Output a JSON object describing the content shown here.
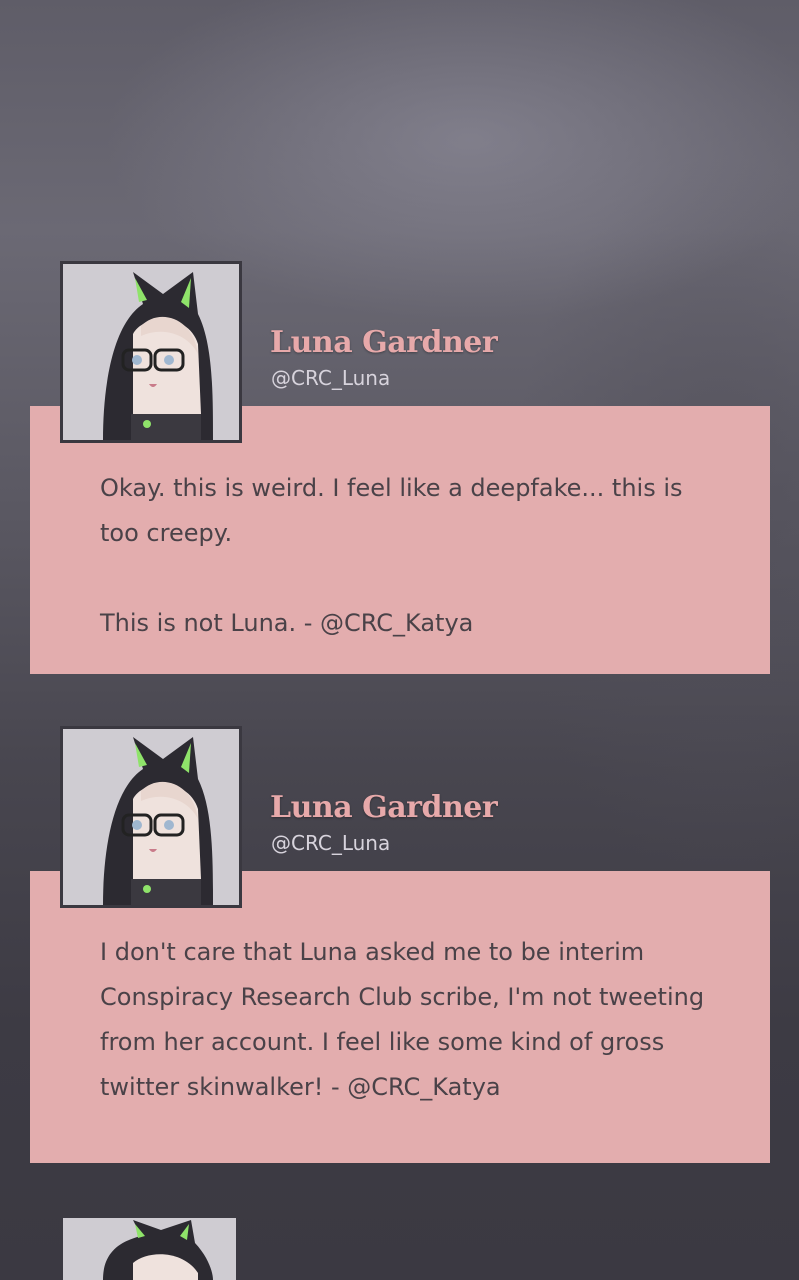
{
  "posts": [
    {
      "author_name": "Luna Gardner",
      "author_handle": "@CRC_Luna",
      "body": "Okay. this is weird. I feel like a deepfake... this is too creepy.\n\nThis is not Luna. - @CRC_Katya"
    },
    {
      "author_name": "Luna Gardner",
      "author_handle": "@CRC_Luna",
      "body": "I don't care that Luna asked me to be interim Conspiracy Research Club scribe, I'm not tweeting from her account. I feel like some kind of gross twitter skinwalker! - @CRC_Katya"
    }
  ],
  "avatar_icon": "hooded-cat-ear-character-avatar",
  "colors": {
    "bubble": "#e3adae",
    "name": "#e7a9aa",
    "handle": "#d7d3dc",
    "body_text": "#4a4248",
    "background": "#3d3b44"
  }
}
